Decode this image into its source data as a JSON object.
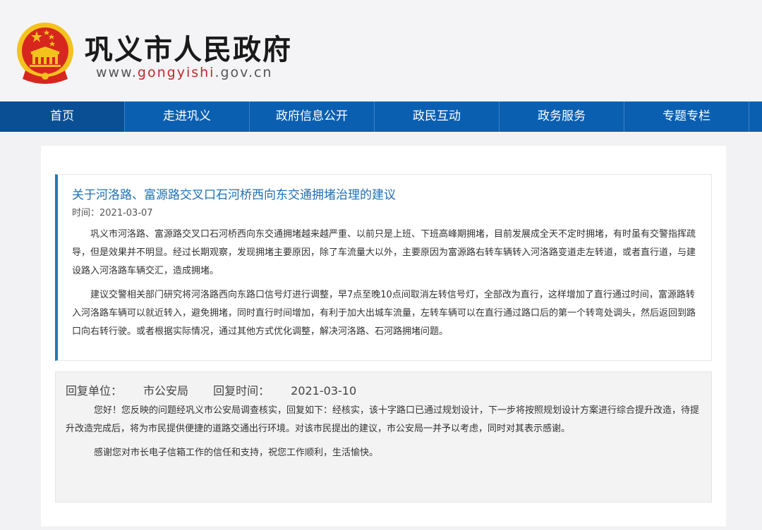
{
  "header": {
    "site_title": "巩义市人民政府",
    "url_prefix": "www.",
    "url_domain": "gongyishi",
    "url_suffix": ".gov.cn"
  },
  "nav": {
    "items": [
      "首页",
      "走进巩义",
      "政府信息公开",
      "政民互动",
      "政务服务",
      "专题专栏"
    ]
  },
  "letter": {
    "title": "关于河洛路、富源路交叉口石河桥西向东交通拥堵治理的建议",
    "date_label": "时间：",
    "date": "2021-03-07",
    "paragraphs": [
      "巩义市河洛路、富源路交叉口石河桥西向东交通拥堵越来越严重、以前只是上班、下班高峰期拥堵，目前发展成全天不定时拥堵，有时虽有交警指挥疏导，但是效果并不明显。经过长期观察，发现拥堵主要原因，除了车流量大以外，主要原因为富源路右转车辆转入河洛路变道走左转道，或者直行道，与建设路入河洛路车辆交汇，造成拥堵。",
      "建议交警相关部门研究将河洛路西向东路口信号灯进行调整，早7点至晚10点间取消左转信号灯，全部改为直行，这样增加了直行通过时间，富源路转入河洛路车辆可以就近转入，避免拥堵，同时直行时间增加，有利于加大出城车流量，左转车辆可以在直行通过路口后的第一个转弯处调头，然后返回到路口向右转行驶。或者根据实际情况，通过其他方式优化调整，解决河洛路、石河路拥堵问题。"
    ]
  },
  "reply": {
    "unit_label": "回复单位：",
    "unit": "市公安局",
    "time_label": "回复时间：",
    "time": "2021-03-10",
    "paragraphs": [
      "您好！您反映的问题经巩义市公安局调查核实，回复如下：经核实，该十字路口已通过规划设计，下一步将按照规划设计方案进行综合提升改造，待提升改造完成后，将为市民提供便捷的道路交通出行环境。对该市民提出的建议，市公安局一并予以考虑，同时对其表示感谢。",
      "感谢您对市长电子信箱工作的信任和支持，祝您工作顺利，生活愉快。"
    ]
  },
  "colors": {
    "nav_bg": "#0b5fb0",
    "accent_blue": "#1f79b8",
    "emblem_red": "#d7261e",
    "emblem_gold": "#f4c21d"
  }
}
